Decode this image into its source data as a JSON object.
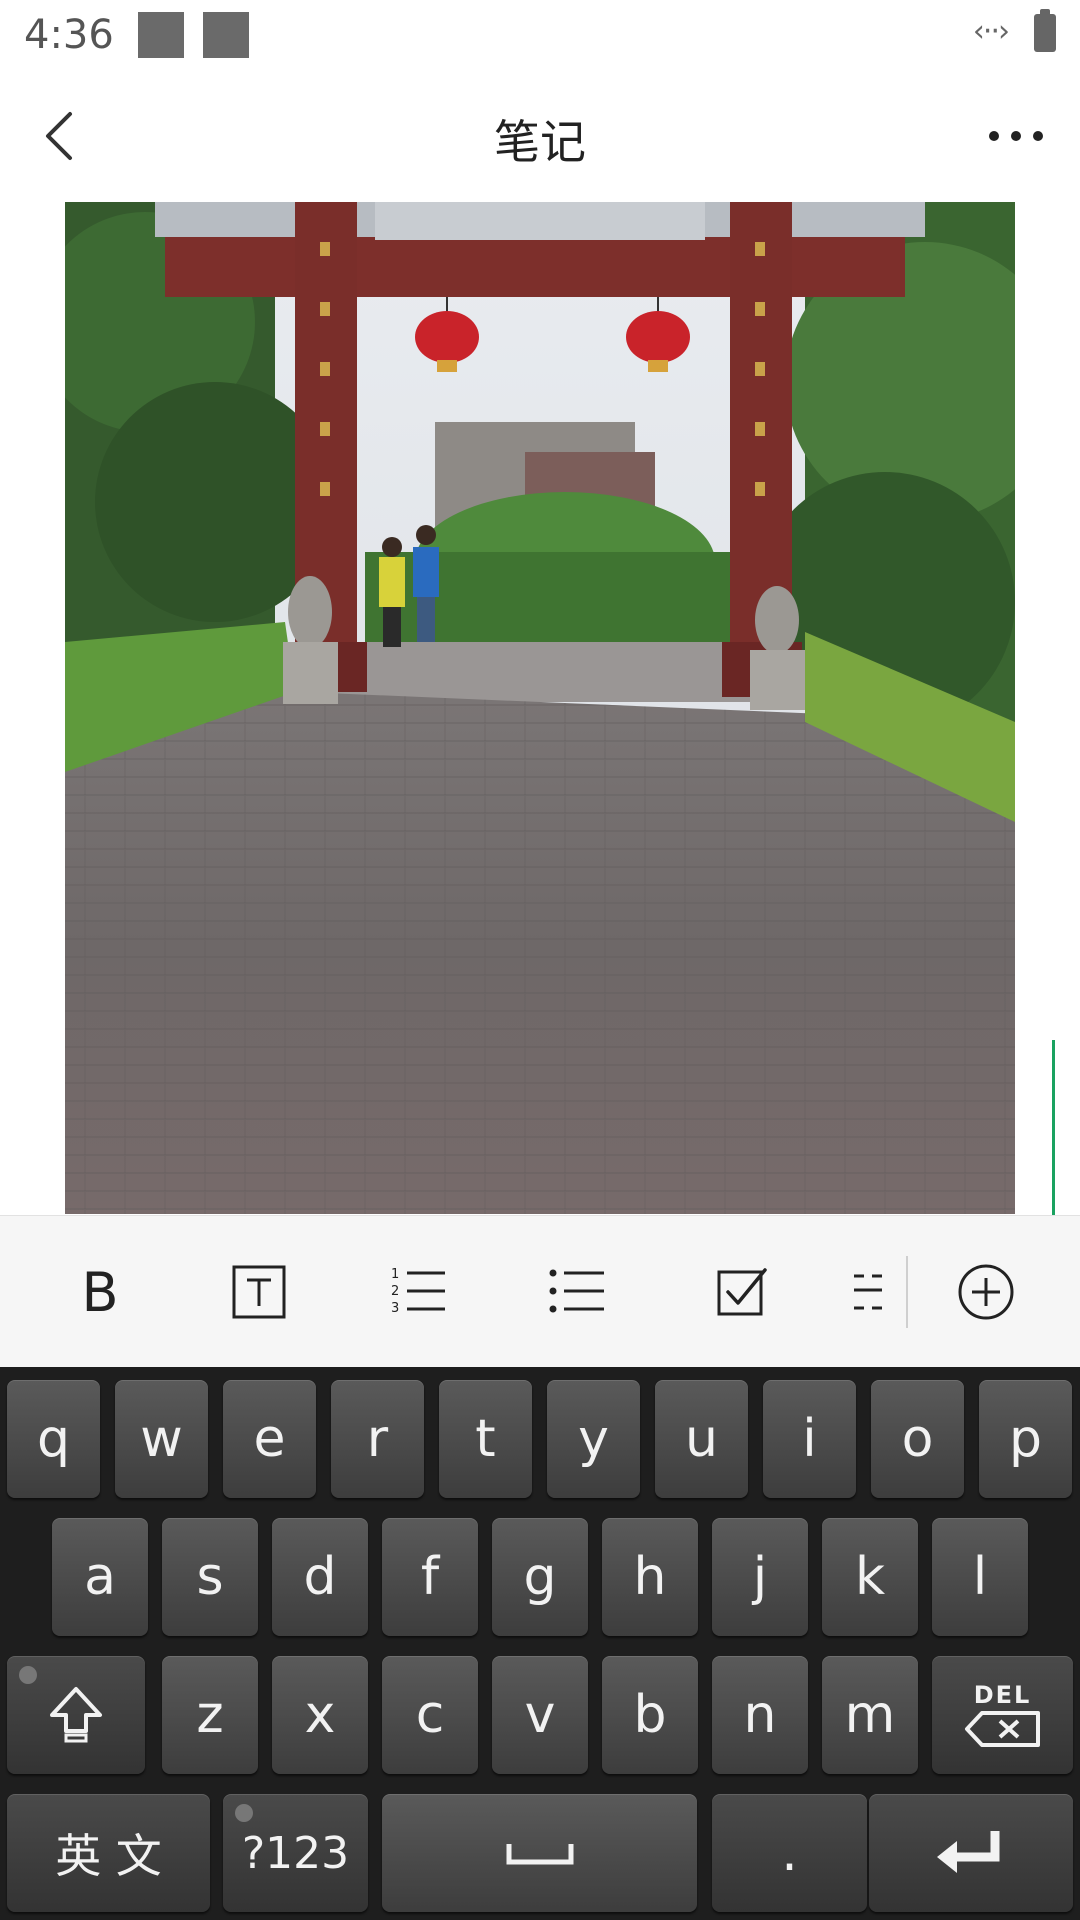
{
  "status_bar": {
    "time": "4:36",
    "data_icon": "data-transfer-icon",
    "battery_icon": "battery-icon"
  },
  "app_bar": {
    "title": "笔记",
    "back_icon": "chevron-left-icon",
    "more_icon": "more-horizontal-icon"
  },
  "photo": {
    "description_icon": "photo-image",
    "accent": "#1aa260"
  },
  "toolbar": {
    "bold_label": "B",
    "text_style_label": "T",
    "items": [
      "bold-icon",
      "text-style-icon",
      "numbered-list-icon",
      "bullet-list-icon",
      "checkbox-icon",
      "divider-icon",
      "add-circle-icon"
    ]
  },
  "keyboard": {
    "row1": [
      "q",
      "w",
      "e",
      "r",
      "t",
      "y",
      "u",
      "i",
      "o",
      "p"
    ],
    "row2": [
      "a",
      "s",
      "d",
      "f",
      "g",
      "h",
      "j",
      "k",
      "l"
    ],
    "row3": [
      "z",
      "x",
      "c",
      "v",
      "b",
      "n",
      "m"
    ],
    "shift_icon": "shift-icon",
    "del_label": "DEL",
    "lang_label": "英 文",
    "symbols_label": "?123",
    "space_icon": "space-icon",
    "period_label": ".",
    "enter_icon": "enter-icon"
  }
}
